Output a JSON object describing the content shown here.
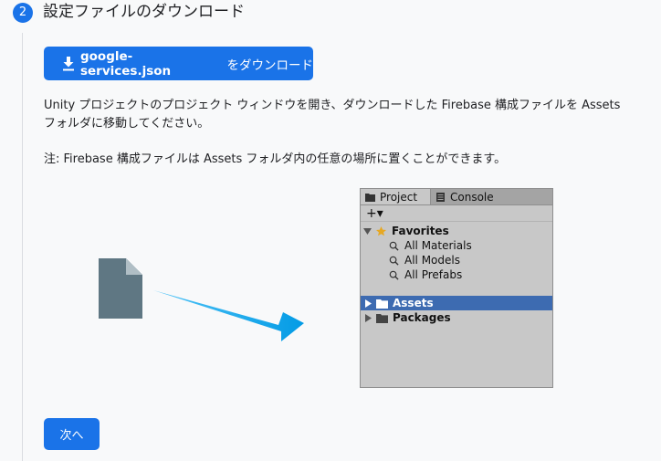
{
  "step": {
    "number": "2",
    "title": "設定ファイルのダウンロード"
  },
  "download_button": {
    "filename": "google-services.json",
    "suffix": " をダウンロード",
    "icon": "download-icon"
  },
  "instructions": {
    "line1": "Unity プロジェクトのプロジェクト ウィンドウを開き、ダウンロードした Firebase 構成ファイルを Assets",
    "line2": "フォルダに移動してください。",
    "note": "注: Firebase 構成ファイルは Assets フォルダ内の任意の場所に置くことができます。"
  },
  "illustration": {
    "file_icon": "file-icon",
    "arrow_color": "#039be5",
    "unity_window": {
      "tabs": [
        {
          "label": "Project",
          "icon": "folder-icon"
        },
        {
          "label": "Console",
          "icon": "console-icon"
        }
      ],
      "toolbar_add": "+▾",
      "tree": {
        "favorites": "Favorites",
        "favorite_items": [
          "All Materials",
          "All Models",
          "All Prefabs"
        ],
        "assets": "Assets",
        "packages": "Packages"
      }
    }
  },
  "next_button": {
    "label": "次へ"
  },
  "colors": {
    "primary": "#1a73e8",
    "selection": "#3d6bb1",
    "favorite_star": "#e6a823"
  }
}
